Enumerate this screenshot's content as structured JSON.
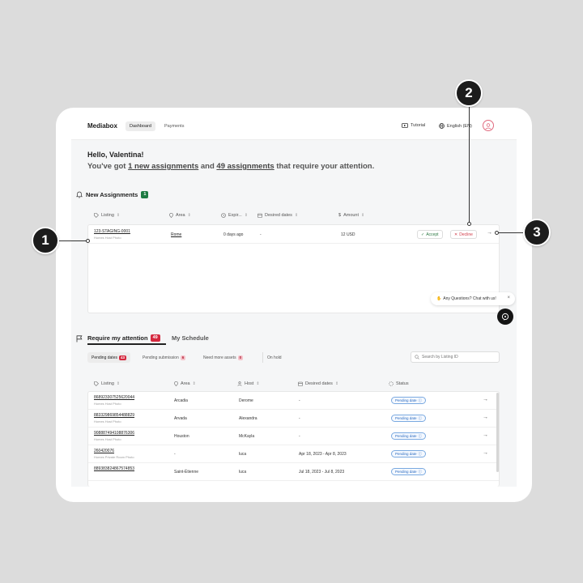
{
  "nav": {
    "brand": "Mediabox",
    "tabs": [
      "Dashboard",
      "Payments"
    ],
    "tutorial": "Tutorial",
    "language": "English (EN)"
  },
  "greeting": {
    "hello": "Hello, Valentina!",
    "prefix": "You've got ",
    "link1": "1 new assignments",
    "middle": " and ",
    "link2": "49 assignments",
    "suffix": " that require your attention."
  },
  "new_assignments": {
    "title": "New Assignments",
    "count": "1",
    "columns": [
      "Listing",
      "Area",
      "Expir...",
      "Desired dates",
      "Amount"
    ],
    "row": {
      "listing": "123-STAGING-0001",
      "listing_sub": "Homes Host Photo",
      "area": "Rome",
      "expires": "0 days ago",
      "dates": "-",
      "amount": "12 USD",
      "accept": "Accept",
      "decline": "Decline"
    }
  },
  "chat": {
    "text": "Any Questions? Chat with us!"
  },
  "attention": {
    "tab_active": "Require my attention",
    "tab_count": "49",
    "tab_other": "My Schedule",
    "filters": [
      {
        "label": "Pending dates",
        "count": "43"
      },
      {
        "label": "Pending submission",
        "count": "6"
      },
      {
        "label": "Need more assets",
        "count": "0"
      },
      {
        "label": "On hold",
        "count": ""
      }
    ],
    "search_placeholder": "Search by Listing ID",
    "columns": [
      "Listing",
      "Area",
      "Host",
      "Desired dates",
      "Status"
    ],
    "rows": [
      {
        "listing": "868923307525620044",
        "sub": "Homes Host Photo",
        "area": "Arcadia",
        "host": "Derome",
        "dates": "-",
        "status": "Pending date"
      },
      {
        "listing": "883329869854488829",
        "sub": "Homes Host Photo",
        "area": "Arvada",
        "host": "Alexandra",
        "dates": "-",
        "status": "Pending date"
      },
      {
        "listing": "908887494108876306",
        "sub": "Homes Host Photo",
        "area": "Houston",
        "host": "McKayla",
        "dates": "-",
        "status": "Pending date"
      },
      {
        "listing": "260420076",
        "sub": "Homes Private Room Photo",
        "area": "-",
        "host": "luca",
        "dates": "Apr 18, 2023 - Apr 8, 2023",
        "status": "Pending date"
      },
      {
        "listing": "889383824867574853",
        "sub": "",
        "area": "Saint-Étienne",
        "host": "luca",
        "dates": "Jul 18, 2023 - Jul 8, 2023",
        "status": "Pending date"
      }
    ]
  },
  "callouts": [
    "1",
    "2",
    "3"
  ],
  "colors": {
    "accent_green": "#1e7b43",
    "accent_red": "#d5293f",
    "status_blue": "#2d6cc0"
  }
}
